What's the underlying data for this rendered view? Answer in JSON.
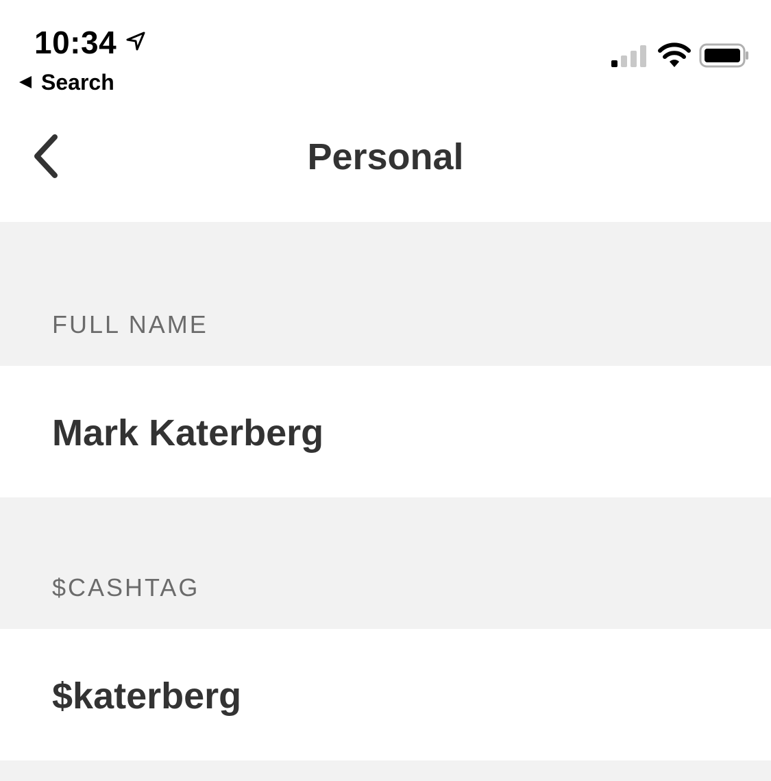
{
  "status_bar": {
    "time": "10:34",
    "back_app_label": "Search",
    "icons": [
      "location-arrow-icon",
      "cellular-signal-icon",
      "wifi-icon",
      "battery-icon"
    ]
  },
  "nav": {
    "title": "Personal",
    "back_icon": "chevron-left-icon"
  },
  "sections": {
    "full_name": {
      "label": "FULL NAME",
      "value": "Mark Katerberg"
    },
    "cashtag": {
      "label": "$CASHTAG",
      "value": "$katerberg"
    }
  },
  "colors": {
    "section_background": "#f2f2f2",
    "primary_text": "#333333",
    "secondary_text": "#6b6b6b"
  }
}
